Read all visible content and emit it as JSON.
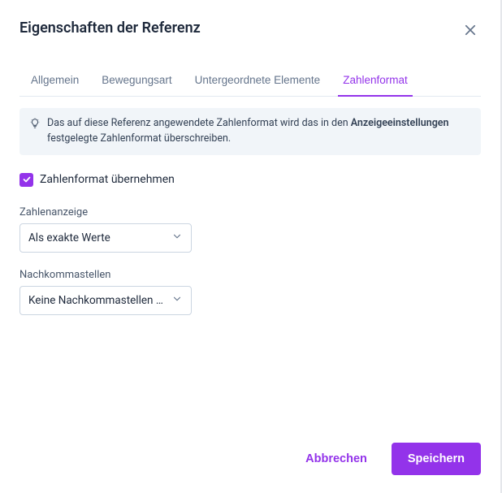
{
  "header": {
    "title": "Eigenschaften der Referenz"
  },
  "tabs": [
    {
      "label": "Allgemein"
    },
    {
      "label": "Bewegungsart"
    },
    {
      "label": "Untergeordnete Elemente"
    },
    {
      "label": "Zahlenformat"
    }
  ],
  "info": {
    "prefix": "Das auf diese Referenz angewendete Zahlenformat wird das in den ",
    "bold": "Anzeigeeinstellungen",
    "suffix": " festgelegte Zahlenformat überschreiben."
  },
  "checkbox": {
    "label": "Zahlenformat übernehmen",
    "checked": true
  },
  "fields": {
    "display": {
      "label": "Zahlenanzeige",
      "value": "Als exakte Werte"
    },
    "decimals": {
      "label": "Nachkommastellen",
      "value": "Keine Nachkommastellen anzeigen"
    }
  },
  "footer": {
    "cancel": "Abbrechen",
    "save": "Speichern"
  }
}
